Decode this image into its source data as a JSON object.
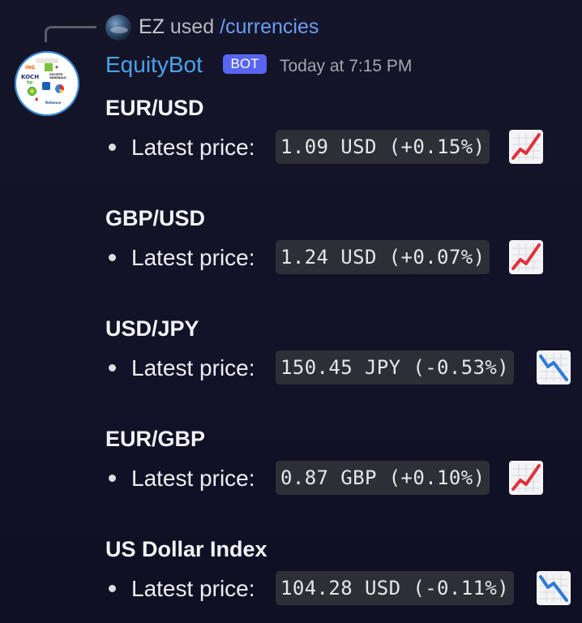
{
  "reply": {
    "user": "EZ",
    "verb": "used",
    "command": "/currencies"
  },
  "message": {
    "bot_name": "EquityBot",
    "badge": "BOT",
    "timestamp": "Today at 7:15 PM"
  },
  "quotes": [
    {
      "heading": "EUR/USD",
      "label": "Latest price:",
      "value": "1.09 USD (+0.15%)",
      "trend": "chart-increasing-icon"
    },
    {
      "heading": "GBP/USD",
      "label": "Latest price:",
      "value": "1.24 USD (+0.07%)",
      "trend": "chart-increasing-icon"
    },
    {
      "heading": "USD/JPY",
      "label": "Latest price:",
      "value": "150.45 JPY (-0.53%)",
      "trend": "chart-decreasing-icon"
    },
    {
      "heading": "EUR/GBP",
      "label": "Latest price:",
      "value": "0.87 GBP (+0.10%)",
      "trend": "chart-increasing-icon"
    },
    {
      "heading": "US Dollar Index",
      "label": "Latest price:",
      "value": "104.28 USD (-0.11%)",
      "trend": "chart-decreasing-icon"
    }
  ],
  "avatar_logos": [
    "ING",
    "KOCH",
    "SOCIETE GENERALE",
    "Chevron",
    "bp",
    "Reliance"
  ],
  "colors": {
    "background": "#131327",
    "bot_name": "#4aa3e8",
    "command": "#6b9df3",
    "badge": "#5865f2",
    "code_background": "#2e2f36",
    "trend_up": "#e0323c",
    "trend_down": "#2f7bd6"
  }
}
